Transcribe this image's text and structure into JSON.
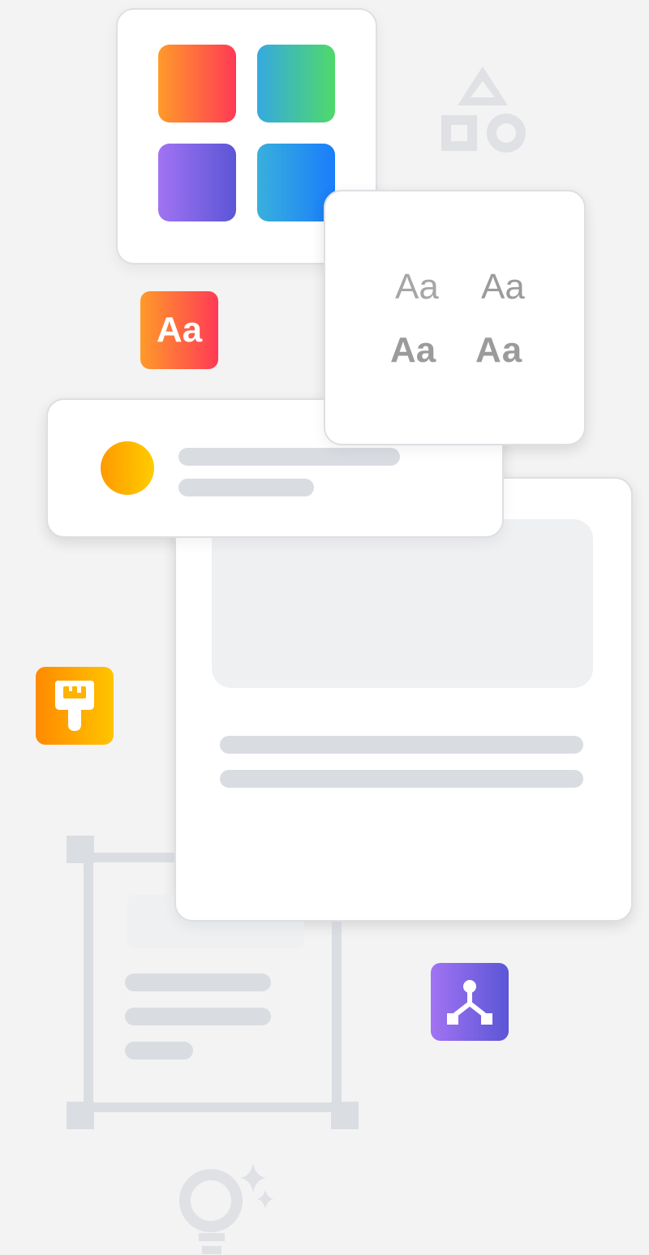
{
  "colors": {
    "background": "#f3f3f4",
    "card": "#ffffff",
    "placeholder_bar": "#d9dde2",
    "placeholder_block": "#eff0f2",
    "muted_icon": "#dfe1e5",
    "type_sample": "#9b9b9b"
  },
  "palette_card": {
    "swatches": [
      {
        "name": "orange-red",
        "from": "#ff9a2a",
        "to": "#ff3a55"
      },
      {
        "name": "teal-green",
        "from": "#36a9e0",
        "to": "#4fd96a"
      },
      {
        "name": "purple",
        "from": "#a173f2",
        "to": "#5b56d6"
      },
      {
        "name": "blue",
        "from": "#38b0dc",
        "to": "#1a7dfb"
      }
    ]
  },
  "typography_card": {
    "samples": [
      "Aa",
      "Aa",
      "Aa",
      "Aa"
    ]
  },
  "text_badge": {
    "label": "Aa",
    "from": "#ff9a2a",
    "to": "#ff3a55"
  },
  "brush_badge": {
    "icon": "paint-brush-icon",
    "from": "#ff8a00",
    "to": "#ffc400"
  },
  "hierarchy_badge": {
    "icon": "hierarchy-icon",
    "from": "#a173f2",
    "to": "#5b56d6"
  },
  "avatar": {
    "from": "#ff9a00",
    "to": "#ffcc00"
  },
  "decor_icons": [
    "shapes-icon",
    "lightbulb-icon",
    "sparkle-icon"
  ]
}
